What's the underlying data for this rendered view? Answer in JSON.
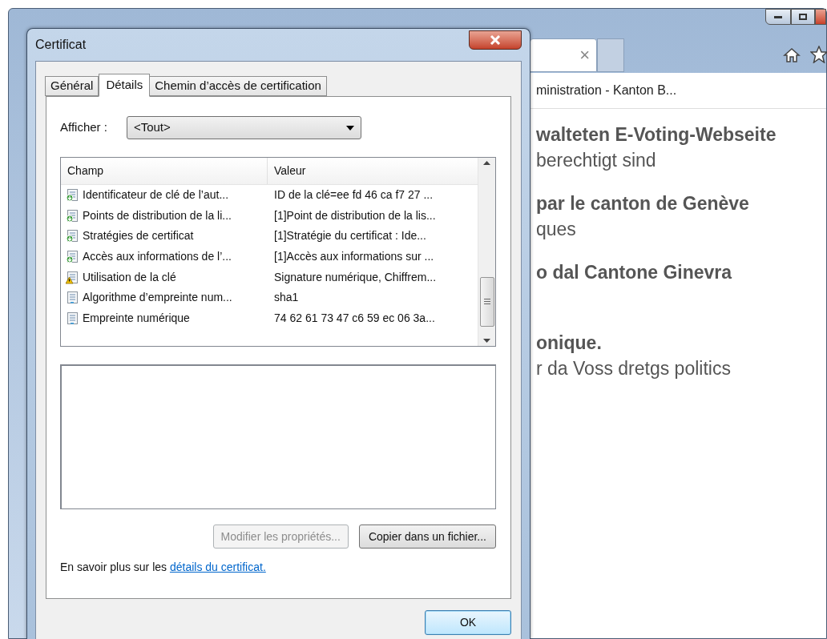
{
  "browser": {
    "tab_close": "×",
    "page_title": "ministration - Kanton B...",
    "paragraphs": [
      [
        {
          "text": "walteten E-Voting-Webseite",
          "bold": true
        },
        {
          "text": "berechtigt sind",
          "bold": false
        }
      ],
      [
        {
          "text": "par le canton de Genève",
          "bold": true
        },
        {
          "text": "ques",
          "bold": false
        }
      ],
      [
        {
          "text": "o dal Cantone Ginevra",
          "bold": true
        }
      ],
      [
        {
          "text": "onique.",
          "bold": true
        },
        {
          "text": "r da Voss dretgs politics",
          "bold": false
        }
      ]
    ]
  },
  "dialog": {
    "title": "Certificat",
    "tabs": [
      {
        "label": "Général",
        "selected": false
      },
      {
        "label": "Détails",
        "selected": true
      },
      {
        "label": "Chemin d’accès de certification",
        "selected": false
      }
    ],
    "show": {
      "label": "Afficher :",
      "value": "<Tout>"
    },
    "columns": [
      "Champ",
      "Valeur"
    ],
    "rows": [
      {
        "kind": "extension",
        "field": "Identificateur de clé de l’aut...",
        "value": "ID de la clé=ee fd 46 ca f7 27 ..."
      },
      {
        "kind": "extension",
        "field": "Points de distribution de la li...",
        "value": "[1]Point de distribution de la lis..."
      },
      {
        "kind": "extension",
        "field": "Stratégies de certificat",
        "value": "[1]Stratégie du certificat : Ide..."
      },
      {
        "kind": "extension",
        "field": "Accès aux informations de l’...",
        "value": "[1]Accès aux informations sur ..."
      },
      {
        "kind": "critical",
        "field": "Utilisation de la clé",
        "value": "Signature numérique, Chiffrem..."
      },
      {
        "kind": "property",
        "field": "Algorithme d’empreinte num...",
        "value": "sha1"
      },
      {
        "kind": "property",
        "field": "Empreinte numérique",
        "value": "74 62 61 73 47 c6 59 ec 06 3a..."
      }
    ],
    "buttons": [
      {
        "label": "Modifier les propriétés...",
        "disabled": true
      },
      {
        "label": "Copier dans un fichier...",
        "disabled": false
      }
    ],
    "learn_more": {
      "text": "En savoir plus sur les",
      "link": "détails du certificat."
    },
    "ok": "OK"
  }
}
